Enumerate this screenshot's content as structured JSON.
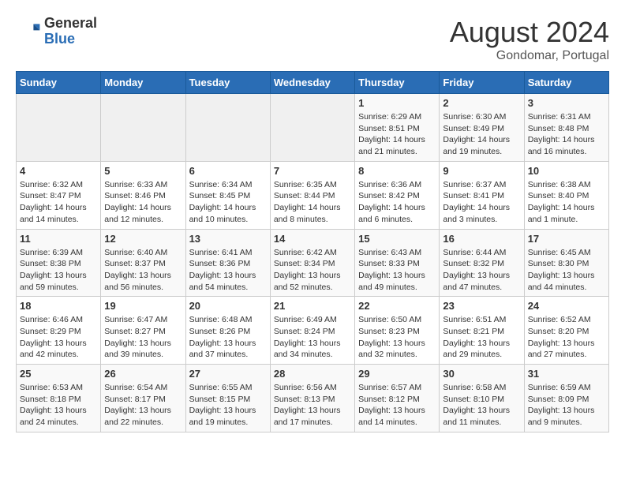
{
  "header": {
    "logo_general": "General",
    "logo_blue": "Blue",
    "month_year": "August 2024",
    "location": "Gondomar, Portugal"
  },
  "days_of_week": [
    "Sunday",
    "Monday",
    "Tuesday",
    "Wednesday",
    "Thursday",
    "Friday",
    "Saturday"
  ],
  "weeks": [
    [
      {
        "day": "",
        "info": ""
      },
      {
        "day": "",
        "info": ""
      },
      {
        "day": "",
        "info": ""
      },
      {
        "day": "",
        "info": ""
      },
      {
        "day": "1",
        "info": "Sunrise: 6:29 AM\nSunset: 8:51 PM\nDaylight: 14 hours and 21 minutes."
      },
      {
        "day": "2",
        "info": "Sunrise: 6:30 AM\nSunset: 8:49 PM\nDaylight: 14 hours and 19 minutes."
      },
      {
        "day": "3",
        "info": "Sunrise: 6:31 AM\nSunset: 8:48 PM\nDaylight: 14 hours and 16 minutes."
      }
    ],
    [
      {
        "day": "4",
        "info": "Sunrise: 6:32 AM\nSunset: 8:47 PM\nDaylight: 14 hours and 14 minutes."
      },
      {
        "day": "5",
        "info": "Sunrise: 6:33 AM\nSunset: 8:46 PM\nDaylight: 14 hours and 12 minutes."
      },
      {
        "day": "6",
        "info": "Sunrise: 6:34 AM\nSunset: 8:45 PM\nDaylight: 14 hours and 10 minutes."
      },
      {
        "day": "7",
        "info": "Sunrise: 6:35 AM\nSunset: 8:44 PM\nDaylight: 14 hours and 8 minutes."
      },
      {
        "day": "8",
        "info": "Sunrise: 6:36 AM\nSunset: 8:42 PM\nDaylight: 14 hours and 6 minutes."
      },
      {
        "day": "9",
        "info": "Sunrise: 6:37 AM\nSunset: 8:41 PM\nDaylight: 14 hours and 3 minutes."
      },
      {
        "day": "10",
        "info": "Sunrise: 6:38 AM\nSunset: 8:40 PM\nDaylight: 14 hours and 1 minute."
      }
    ],
    [
      {
        "day": "11",
        "info": "Sunrise: 6:39 AM\nSunset: 8:38 PM\nDaylight: 13 hours and 59 minutes."
      },
      {
        "day": "12",
        "info": "Sunrise: 6:40 AM\nSunset: 8:37 PM\nDaylight: 13 hours and 56 minutes."
      },
      {
        "day": "13",
        "info": "Sunrise: 6:41 AM\nSunset: 8:36 PM\nDaylight: 13 hours and 54 minutes."
      },
      {
        "day": "14",
        "info": "Sunrise: 6:42 AM\nSunset: 8:34 PM\nDaylight: 13 hours and 52 minutes."
      },
      {
        "day": "15",
        "info": "Sunrise: 6:43 AM\nSunset: 8:33 PM\nDaylight: 13 hours and 49 minutes."
      },
      {
        "day": "16",
        "info": "Sunrise: 6:44 AM\nSunset: 8:32 PM\nDaylight: 13 hours and 47 minutes."
      },
      {
        "day": "17",
        "info": "Sunrise: 6:45 AM\nSunset: 8:30 PM\nDaylight: 13 hours and 44 minutes."
      }
    ],
    [
      {
        "day": "18",
        "info": "Sunrise: 6:46 AM\nSunset: 8:29 PM\nDaylight: 13 hours and 42 minutes."
      },
      {
        "day": "19",
        "info": "Sunrise: 6:47 AM\nSunset: 8:27 PM\nDaylight: 13 hours and 39 minutes."
      },
      {
        "day": "20",
        "info": "Sunrise: 6:48 AM\nSunset: 8:26 PM\nDaylight: 13 hours and 37 minutes."
      },
      {
        "day": "21",
        "info": "Sunrise: 6:49 AM\nSunset: 8:24 PM\nDaylight: 13 hours and 34 minutes."
      },
      {
        "day": "22",
        "info": "Sunrise: 6:50 AM\nSunset: 8:23 PM\nDaylight: 13 hours and 32 minutes."
      },
      {
        "day": "23",
        "info": "Sunrise: 6:51 AM\nSunset: 8:21 PM\nDaylight: 13 hours and 29 minutes."
      },
      {
        "day": "24",
        "info": "Sunrise: 6:52 AM\nSunset: 8:20 PM\nDaylight: 13 hours and 27 minutes."
      }
    ],
    [
      {
        "day": "25",
        "info": "Sunrise: 6:53 AM\nSunset: 8:18 PM\nDaylight: 13 hours and 24 minutes."
      },
      {
        "day": "26",
        "info": "Sunrise: 6:54 AM\nSunset: 8:17 PM\nDaylight: 13 hours and 22 minutes."
      },
      {
        "day": "27",
        "info": "Sunrise: 6:55 AM\nSunset: 8:15 PM\nDaylight: 13 hours and 19 minutes."
      },
      {
        "day": "28",
        "info": "Sunrise: 6:56 AM\nSunset: 8:13 PM\nDaylight: 13 hours and 17 minutes."
      },
      {
        "day": "29",
        "info": "Sunrise: 6:57 AM\nSunset: 8:12 PM\nDaylight: 13 hours and 14 minutes."
      },
      {
        "day": "30",
        "info": "Sunrise: 6:58 AM\nSunset: 8:10 PM\nDaylight: 13 hours and 11 minutes."
      },
      {
        "day": "31",
        "info": "Sunrise: 6:59 AM\nSunset: 8:09 PM\nDaylight: 13 hours and 9 minutes."
      }
    ]
  ]
}
